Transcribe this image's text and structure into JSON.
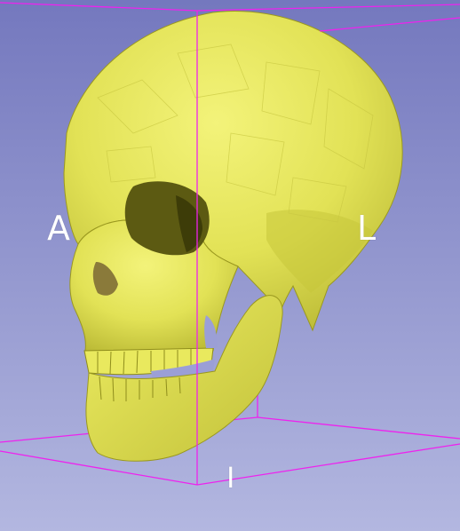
{
  "view": {
    "background_top": "#7478be",
    "background_bottom": "#b3b7e0",
    "bounding_box_color": "#ee22ee",
    "model_color": "#e8e85a",
    "model_shadow": "#7c7a1a",
    "icon": "skull-model-icon"
  },
  "orientation": {
    "left": "A",
    "right": "L",
    "bottom": "I"
  }
}
